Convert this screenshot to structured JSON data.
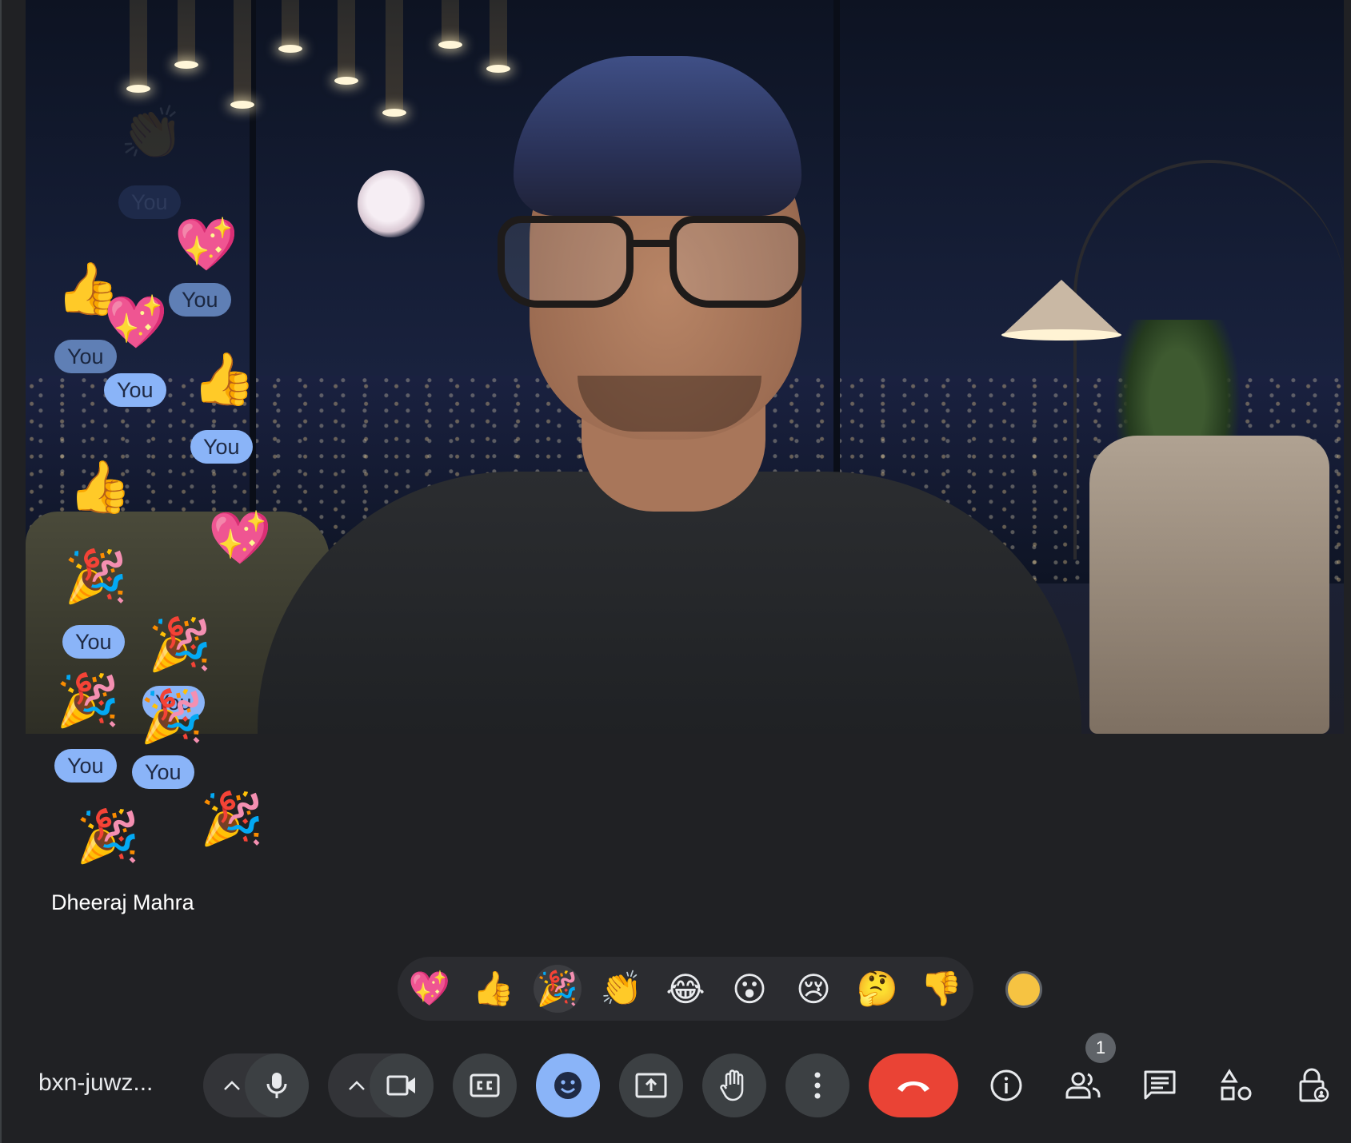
{
  "meeting": {
    "code": "bxn-juwz..."
  },
  "participant": {
    "name": "Dheeraj Mahra"
  },
  "reactions_overlay": {
    "you_label": "You",
    "items": [
      {
        "emoji": "👏",
        "faded": true
      },
      {
        "emoji": "💖"
      },
      {
        "emoji": "👍"
      },
      {
        "emoji": "💖"
      },
      {
        "emoji": "👍"
      },
      {
        "emoji": "👍"
      },
      {
        "emoji": "💖"
      },
      {
        "emoji": "🎉"
      },
      {
        "emoji": "🎉"
      },
      {
        "emoji": "🎉"
      },
      {
        "emoji": "🎉"
      },
      {
        "emoji": "🎉"
      },
      {
        "emoji": "🎉"
      }
    ]
  },
  "reaction_picker": {
    "emojis": [
      "💖",
      "👍",
      "🎉",
      "👏",
      "😂",
      "😮",
      "😢",
      "🤔",
      "👎"
    ],
    "selected_index": 2,
    "skin_tone_color": "#f6c342"
  },
  "controls": {
    "people_count": "1",
    "icons": [
      "chevron-up-icon",
      "microphone-icon",
      "chevron-up-icon",
      "camera-icon",
      "captions-icon",
      "emoji-icon",
      "present-icon",
      "raise-hand-icon",
      "more-options-icon",
      "end-call-icon",
      "info-icon",
      "people-icon",
      "chat-icon",
      "activities-icon",
      "host-controls-icon"
    ]
  },
  "colors": {
    "accent": "#8ab4f8",
    "end_call": "#ea4335",
    "background": "#202124",
    "control": "#3c4043"
  }
}
